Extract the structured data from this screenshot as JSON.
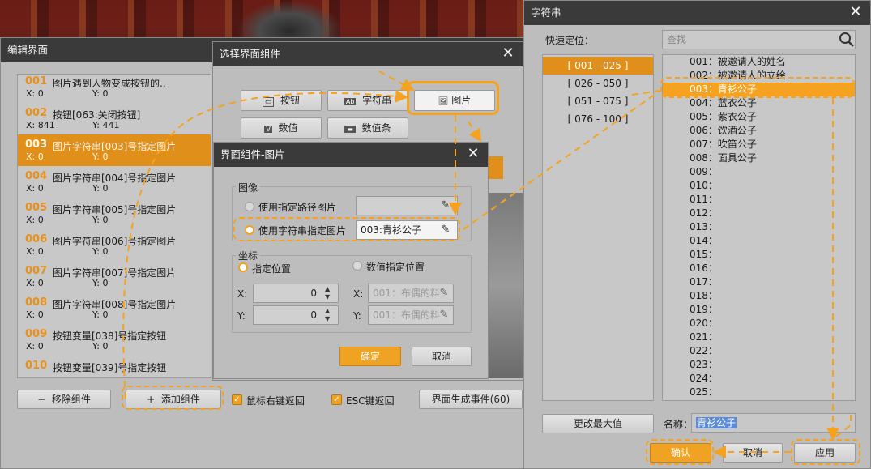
{
  "colors": {
    "accent": "#f4a21f",
    "titlebar": "#3a3a3a",
    "panel": "#bdbdbd"
  },
  "edit_window": {
    "title": "编辑界面",
    "items": [
      {
        "num": "001",
        "name": "图片遇到人物变成按钮的..",
        "x": "X:  0",
        "y": "Y:  0"
      },
      {
        "num": "002",
        "name": "按钮[063:关闭按钮]",
        "x": "X:  841",
        "y": "Y:  441"
      },
      {
        "num": "003",
        "name": "图片字符串[003]号指定图片",
        "x": "X:  0",
        "y": "Y:  0"
      },
      {
        "num": "004",
        "name": "图片字符串[004]号指定图片",
        "x": "X:  0",
        "y": "Y:  0"
      },
      {
        "num": "005",
        "name": "图片字符串[005]号指定图片",
        "x": "X:  0",
        "y": "Y:  0"
      },
      {
        "num": "006",
        "name": "图片字符串[006]号指定图片",
        "x": "X:  0",
        "y": "Y:  0"
      },
      {
        "num": "007",
        "name": "图片字符串[007]号指定图片",
        "x": "X:  0",
        "y": "Y:  0"
      },
      {
        "num": "008",
        "name": "图片字符串[008]号指定图片",
        "x": "X:  0",
        "y": "Y:  0"
      },
      {
        "num": "009",
        "name": "按钮变量[038]号指定按钮",
        "x": "X:  0",
        "y": "Y:  0"
      },
      {
        "num": "010",
        "name": "按钮变量[039]号指定按钮",
        "x": "",
        "y": ""
      }
    ],
    "remove_label": "移除组件",
    "add_label": "添加组件",
    "right_click_return": "鼠标右键返回",
    "esc_return": "ESC键返回",
    "gen_event_label": "界面生成事件(60)"
  },
  "component_window": {
    "title": "选择界面组件",
    "buttons": [
      "按钮",
      "字符串",
      "图片",
      "数值",
      "数值条"
    ]
  },
  "image_window": {
    "title": "界面组件-图片",
    "image_group": "图像",
    "use_path": "使用指定路径图片",
    "use_string": "使用字符串指定图片",
    "string_value": "003:青衫公子",
    "coord_group": "坐标",
    "fixed_pos": "指定位置",
    "var_pos": "数值指定位置",
    "x_label": "X:",
    "y_label": "Y:",
    "x_value": "0",
    "y_value": "0",
    "x_var_placeholder": "001：布偶的料",
    "y_var_placeholder": "001：布偶的料",
    "ok_label": "确定",
    "cancel_label": "取消"
  },
  "string_window": {
    "title": "字符串",
    "quick_locate": "快速定位：",
    "search_placeholder": "查找",
    "categories": [
      "[ 001 - 025 ]",
      "[ 026 - 050 ]",
      "[ 051 - 075 ]",
      "[ 076 - 100 ]"
    ],
    "strings": [
      "001：被邀请人的姓名",
      "002：被邀请人的立绘",
      "003：青衫公子",
      "004：蓝衣公子",
      "005：紫衣公子",
      "006：饮酒公子",
      "007：吹笛公子",
      "008：面具公子",
      "009：",
      "010：",
      "011：",
      "012：",
      "013：",
      "014：",
      "015：",
      "016：",
      "017：",
      "018：",
      "019：",
      "020：",
      "021：",
      "022：",
      "023：",
      "024：",
      "025："
    ],
    "update_max_label": "更改最大值",
    "name_label": "名称：",
    "name_value": "青衫公子",
    "confirm_label": "确认",
    "cancel_label": "取消",
    "apply_label": "应用"
  }
}
